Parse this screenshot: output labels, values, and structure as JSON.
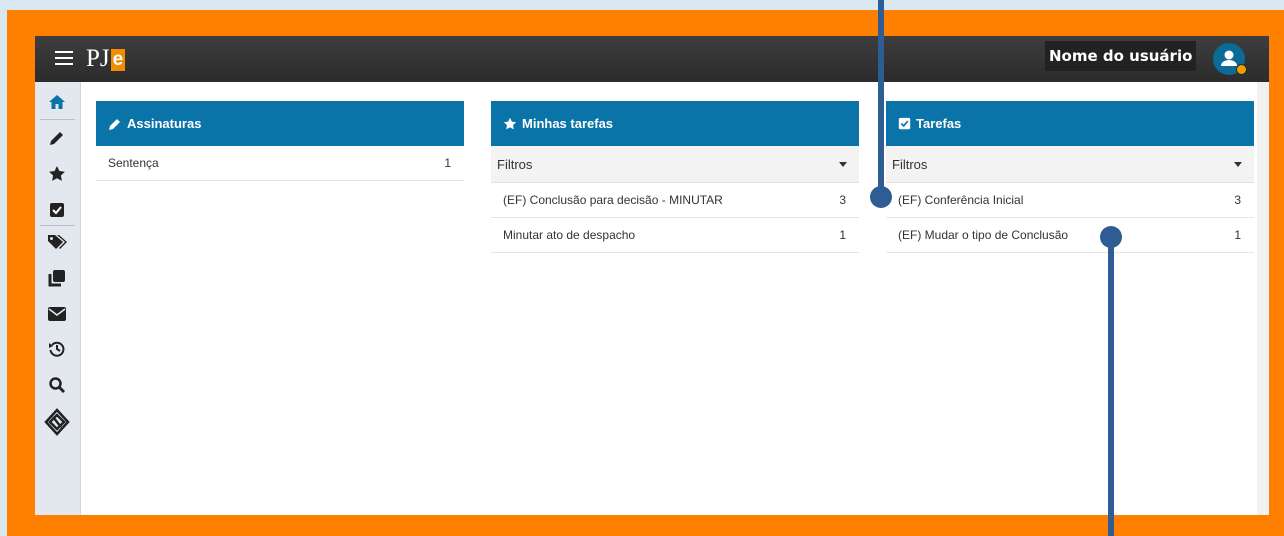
{
  "header": {
    "logo_pj": "PJ",
    "logo_e": "e",
    "user_name": "Nome do usuário"
  },
  "sidebar": {
    "icons": [
      "home-icon",
      "pencil-icon",
      "star-icon",
      "checkbox-icon",
      "tags-icon",
      "documents-icon",
      "envelope-icon",
      "history-icon",
      "search-icon",
      "pje-diamond-icon"
    ]
  },
  "panels": {
    "assinaturas": {
      "title": "Assinaturas",
      "rows": [
        {
          "label": "Sentença",
          "count": "1"
        }
      ]
    },
    "minhas_tarefas": {
      "title": "Minhas tarefas",
      "filter": "Filtros",
      "rows": [
        {
          "label": "(EF) Conclusão para decisão - MINUTAR",
          "count": "3"
        },
        {
          "label": "Minutar ato de despacho",
          "count": "1"
        }
      ]
    },
    "tarefas": {
      "title": "Tarefas",
      "filter": "Filtros",
      "rows": [
        {
          "label": "(EF) Conferência Inicial",
          "count": "3"
        },
        {
          "label": "(EF) Mudar o tipo de Conclusão",
          "count": "1"
        }
      ]
    }
  },
  "colors": {
    "frame": "#ff7f00",
    "panel_header": "#0a73a8",
    "topbar": "#333333",
    "callout": "#2f5d93",
    "logo_accent": "#f28c00"
  }
}
